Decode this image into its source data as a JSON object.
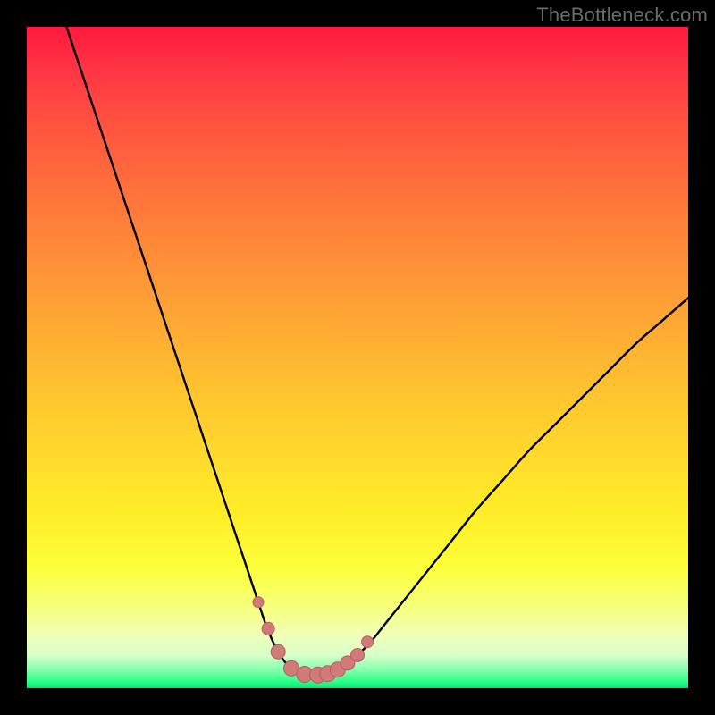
{
  "watermark": "TheBottleneck.com",
  "colors": {
    "page_bg": "#000000",
    "gradient_top": "#ff1a3c",
    "gradient_mid": "#ffd82c",
    "gradient_bottom": "#00e676",
    "curve_stroke": "#000000",
    "marker_fill": "#d07a7a",
    "marker_stroke": "#b85c5c"
  },
  "chart_data": {
    "type": "line",
    "title": "",
    "xlabel": "",
    "ylabel": "",
    "xlim": [
      0,
      100
    ],
    "ylim": [
      0,
      100
    ],
    "grid": false,
    "legend": false,
    "series": [
      {
        "name": "bottleneck-curve",
        "x": [
          6,
          8,
          10,
          12,
          14,
          16,
          18,
          20,
          22,
          24,
          26,
          28,
          30,
          31,
          32,
          33,
          34,
          35,
          36,
          37,
          38,
          39,
          40,
          41,
          42,
          43,
          44,
          45,
          46,
          48,
          50,
          52,
          54,
          56,
          60,
          64,
          68,
          72,
          76,
          80,
          84,
          88,
          92,
          96,
          100
        ],
        "y": [
          100,
          94,
          88,
          82,
          76,
          70,
          64,
          58,
          52,
          46,
          40,
          34,
          28,
          25,
          22,
          19,
          16,
          13,
          10,
          7.5,
          5.5,
          4,
          3,
          2.4,
          2.1,
          2,
          2,
          2.1,
          2.4,
          3.4,
          5,
          7,
          9.5,
          12,
          17,
          22,
          27,
          31.5,
          36,
          40,
          44,
          48,
          52,
          55.5,
          59
        ]
      }
    ],
    "markers": {
      "name": "highlight-points",
      "x": [
        35,
        36.5,
        38,
        40,
        42,
        44,
        45.5,
        47,
        48.5,
        50,
        51.5
      ],
      "y": [
        13,
        9,
        5.5,
        3,
        2.1,
        2,
        2.2,
        2.8,
        3.8,
        5,
        7
      ],
      "r": [
        6,
        7,
        8,
        8.5,
        9,
        9,
        9,
        8.5,
        8,
        7.5,
        6.5
      ]
    }
  }
}
